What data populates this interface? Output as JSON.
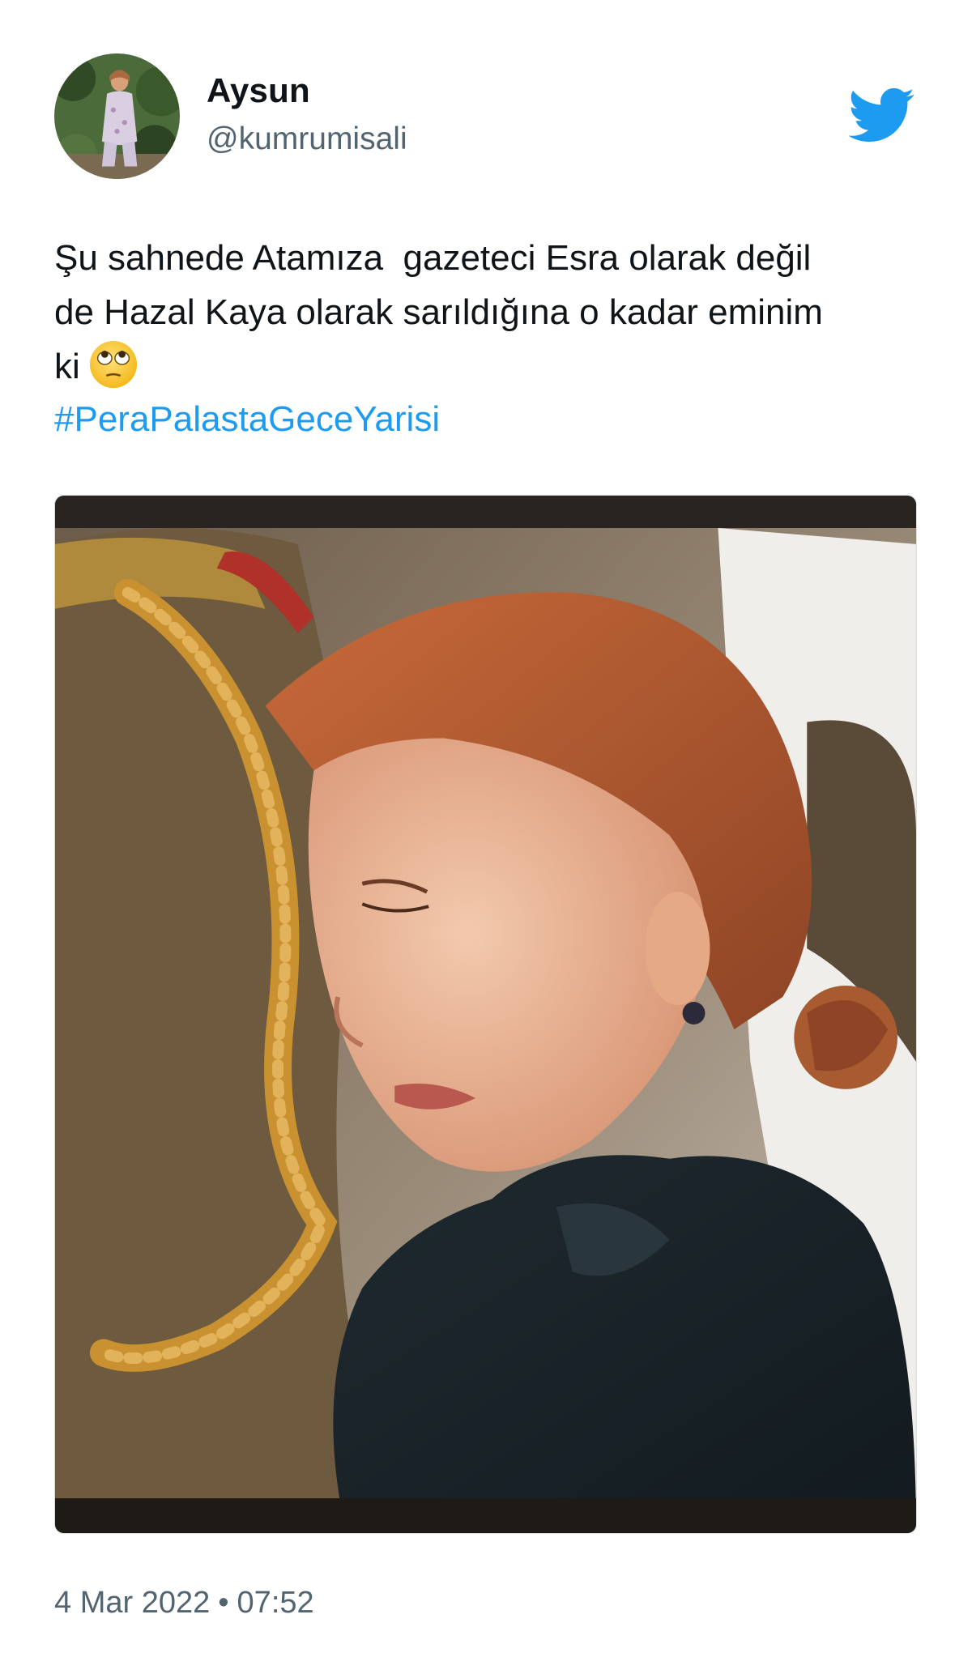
{
  "user": {
    "display_name": "Aysun",
    "handle": "@kumrumisali"
  },
  "tweet": {
    "text": "Şu sahnede Atamıza  gazeteci Esra olarak değil\nde Hazal Kaya olarak sarıldığına o kadar eminim\nki",
    "emoji": "face-with-rolling-eyes-icon",
    "hashtag": "#PeraPalastaGeceYarisi",
    "date": "4 Mar 2022",
    "separator": "•",
    "time": "07:52"
  },
  "colors": {
    "link": "#1d9bf0",
    "secondary_text": "#536471",
    "twitter_brand": "#1d9bf0"
  },
  "icons": {
    "brand": "twitter-bird-icon"
  }
}
